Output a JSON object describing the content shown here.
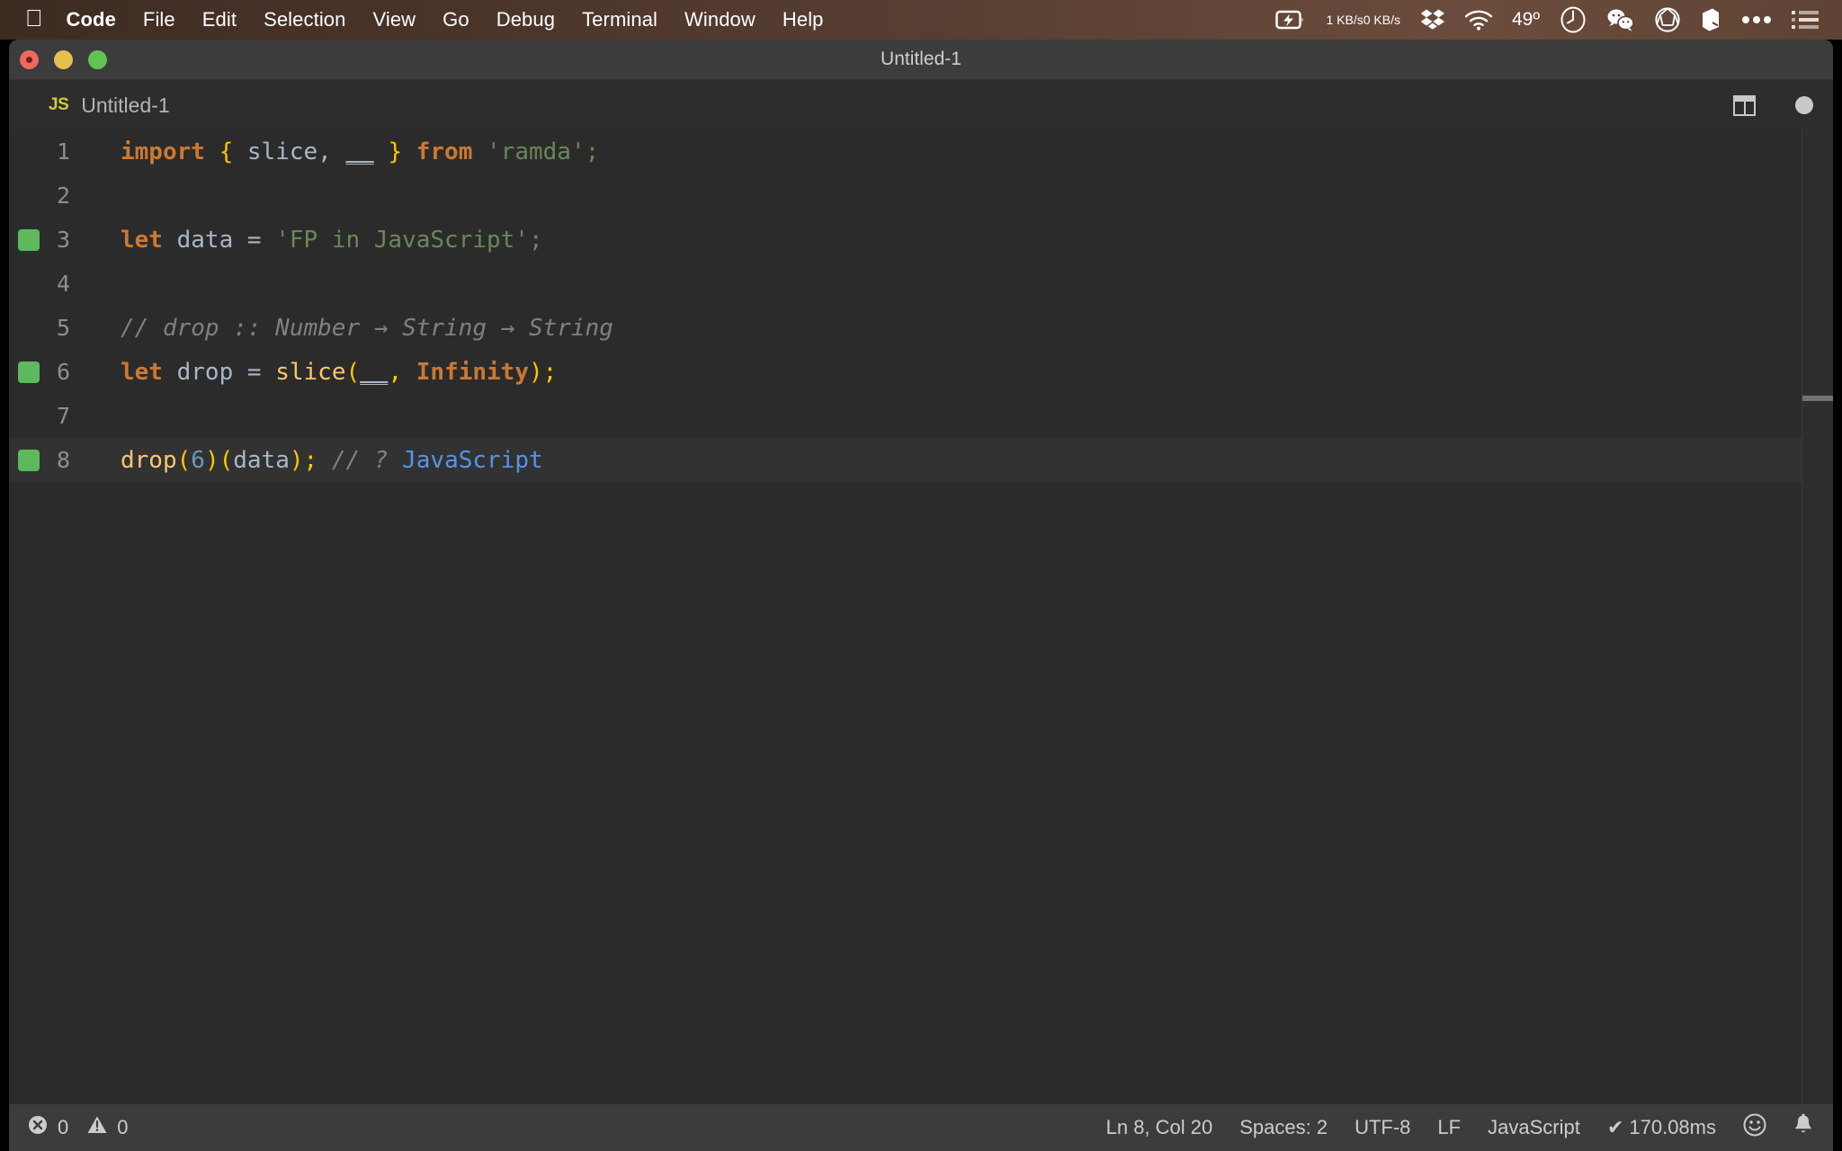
{
  "menubar": {
    "apple_icon": "apple-logo",
    "items": [
      {
        "label": "Code",
        "bold": true
      },
      {
        "label": "File",
        "bold": false
      },
      {
        "label": "Edit",
        "bold": false
      },
      {
        "label": "Selection",
        "bold": false
      },
      {
        "label": "View",
        "bold": false
      },
      {
        "label": "Go",
        "bold": false
      },
      {
        "label": "Debug",
        "bold": false
      },
      {
        "label": "Terminal",
        "bold": false
      },
      {
        "label": "Window",
        "bold": false
      },
      {
        "label": "Help",
        "bold": false
      }
    ],
    "tray": {
      "battery_icon": "battery-charging-icon",
      "net_up": "1 KB/s",
      "net_down": "0 KB/s",
      "dropbox_icon": "dropbox-icon",
      "wifi_icon": "wifi-icon",
      "temperature": "49º",
      "clock_icon": "clock-icon",
      "wechat_icon": "wechat-icon",
      "aperture_icon": "aperture-icon",
      "cube_icon": "cube-icon",
      "more_icon": "ellipsis-icon",
      "list_icon": "control-center-icon"
    }
  },
  "window": {
    "title": "Untitled-1",
    "traffic": {
      "close": "close-window-button",
      "minimize": "minimize-window-button",
      "zoom": "zoom-window-button"
    }
  },
  "tabbar": {
    "tab": {
      "badge": "JS",
      "label": "Untitled-1"
    },
    "actions": {
      "split_editor": "split-editor-icon",
      "unsaved_indicator": "unsaved-dot-icon"
    }
  },
  "editor": {
    "language": "JavaScript",
    "lines": [
      {
        "n": "1",
        "mark": false,
        "active": false
      },
      {
        "n": "2",
        "mark": false,
        "active": false
      },
      {
        "n": "3",
        "mark": true,
        "active": false
      },
      {
        "n": "4",
        "mark": false,
        "active": false
      },
      {
        "n": "5",
        "mark": false,
        "active": false
      },
      {
        "n": "6",
        "mark": true,
        "active": false
      },
      {
        "n": "7",
        "mark": false,
        "active": false
      },
      {
        "n": "8",
        "mark": true,
        "active": true
      }
    ],
    "text": {
      "l1": "import { slice, __ } from 'ramda';",
      "l1_import": "import",
      "l1_brace_open": "{",
      "l1_slice": " slice, ",
      "l1_underscore": "__",
      "l1_brace_close": "}",
      "l1_from": "from",
      "l1_module": "'ramda';",
      "l3": "let data = 'FP in JavaScript';",
      "l3_let": "let",
      "l3_name": " data = ",
      "l3_str": "'FP in JavaScript';",
      "l5": "// drop :: Number → String → String",
      "l6": "let drop = slice(__, Infinity);",
      "l6_let": "let",
      "l6_name": " drop = ",
      "l6_fn": "slice",
      "l6_paren_open": "(",
      "l6_underscore": "__",
      "l6_comma": ", ",
      "l6_infinity": "Infinity",
      "l6_paren_close": ")",
      "l6_semi": ";",
      "l8_fn": "drop",
      "l8_p1": "(",
      "l8_num": "6",
      "l8_p2": ")(",
      "l8_arg": "data",
      "l8_p3": ")",
      "l8_semi": ";",
      "l8_comment": " // ? ",
      "l8_result": "JavaScript"
    }
  },
  "statusbar": {
    "errors_icon": "error-circle-icon",
    "errors": "0",
    "warnings_icon": "warning-triangle-icon",
    "warnings": "0",
    "cursor_position": "Ln 8, Col 20",
    "indentation": "Spaces: 2",
    "encoding": "UTF-8",
    "eol": "LF",
    "language_mode": "JavaScript",
    "runtime": "✔ 170.08ms",
    "feedback_icon": "smiley-icon",
    "notifications_icon": "bell-icon"
  },
  "colors": {
    "menubar_bg": "#5a4033",
    "titlebar_bg": "#3c3c3c",
    "editor_bg": "#2b2b2b",
    "statusbar_bg": "#3c3c3c",
    "keyword": "#cc7832",
    "string": "#6a8759",
    "number": "#6897bb",
    "comment": "#808080",
    "function": "#ffc66d",
    "brace": "#ffc600",
    "identifier": "#a9b7c6",
    "result": "#5394ec",
    "gutter_mark": "#5eb85e",
    "js_badge": "#cbcb41"
  }
}
